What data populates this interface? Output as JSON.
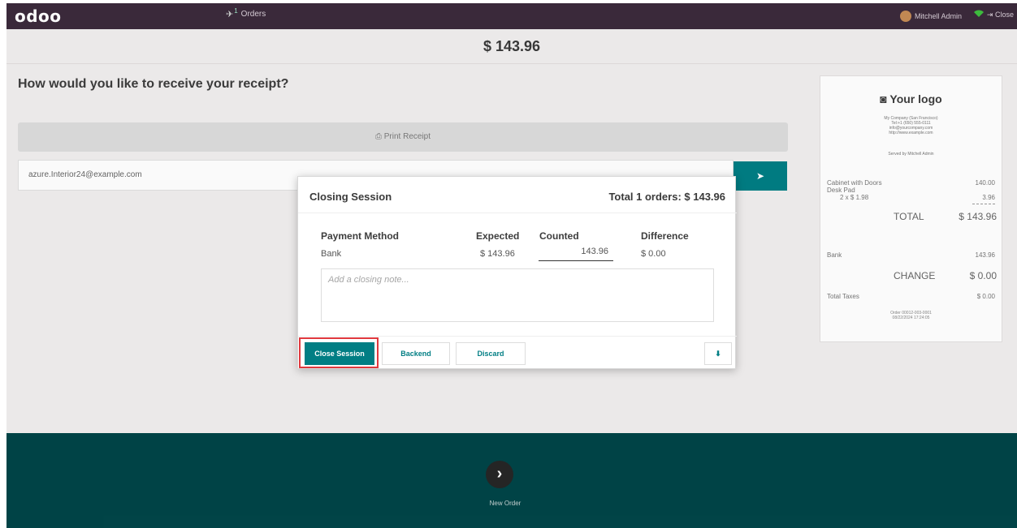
{
  "topbar": {
    "logo": "odoo",
    "orders_label": "Orders",
    "orders_badge": "1",
    "user_name": "Mitchell Admin",
    "close_label": "Close"
  },
  "amount": "$ 143.96",
  "main": {
    "question": "How would you like to receive your receipt?",
    "print_label": "Print Receipt",
    "email_value": "azure.Interior24@example.com"
  },
  "receipt": {
    "logo_text": "Your logo",
    "company_lines": [
      "My Company (San Francisco)",
      "Tel:+1 (650) 555-0111",
      "info@yourcompany.com",
      "http://www.example.com"
    ],
    "served_by": "Served by Mitchell Admin",
    "item1_name": "Cabinet with Doors",
    "item1_price": "140.00",
    "item2_name": "Desk Pad",
    "item2_qty": "2 x $ 1.98",
    "item2_price": "3.96",
    "total_label": "TOTAL",
    "total_value": "$ 143.96",
    "payment_name": "Bank",
    "payment_value": "143.96",
    "change_label": "CHANGE",
    "change_value": "$ 0.00",
    "taxes_label": "Total Taxes",
    "taxes_value": "$ 0.00",
    "order_lines": [
      "Order 00012-003-0001",
      "08/22/2024 17:24:05"
    ]
  },
  "dialog": {
    "title": "Closing Session",
    "total": "Total 1 orders: $ 143.96",
    "headers": {
      "method": "Payment Method",
      "expected": "Expected",
      "counted": "Counted",
      "difference": "Difference"
    },
    "row": {
      "method": "Bank",
      "expected": "$ 143.96",
      "counted": "143.96",
      "difference": "$ 0.00"
    },
    "note_placeholder": "Add a closing note...",
    "buttons": {
      "close": "Close Session",
      "backend": "Backend",
      "discard": "Discard"
    }
  },
  "bottom": {
    "new_order": "New Order"
  },
  "colors": {
    "topbar": "#3c2a3c",
    "accent": "#017e84",
    "bottom_bar": "#014548",
    "highlight": "#e0393e"
  }
}
